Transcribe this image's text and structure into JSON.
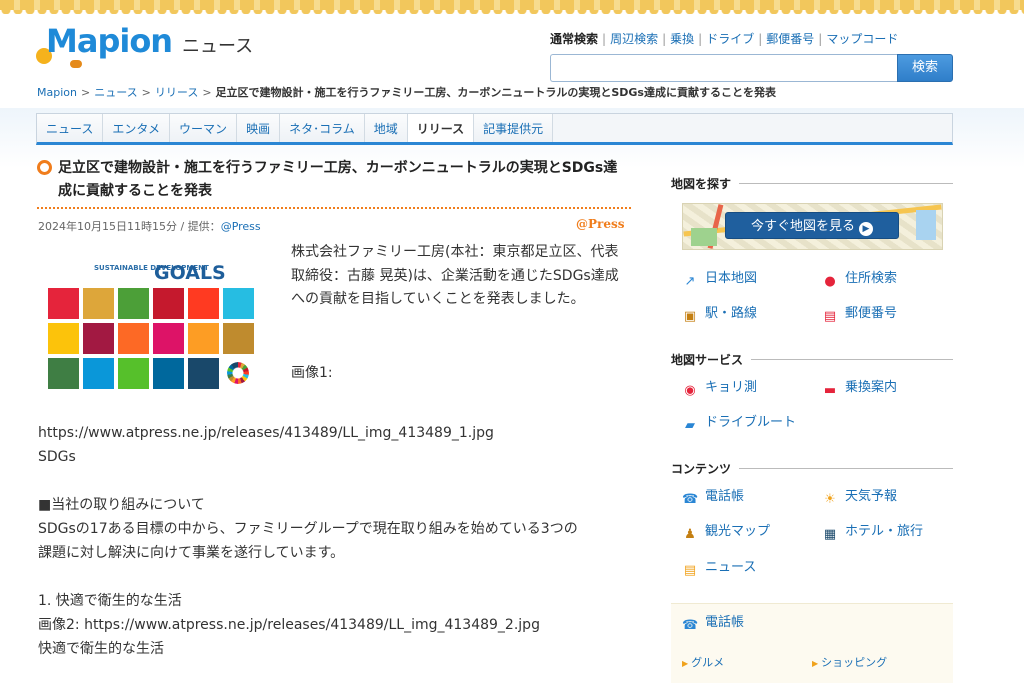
{
  "header": {
    "logo_text": "Mapion",
    "section": "ニュース",
    "search_links": [
      "通常検索",
      "周辺検索",
      "乗換",
      "ドライブ",
      "郵便番号",
      "マップコード"
    ],
    "search_current": "通常検索",
    "search_value": "",
    "search_button": "検索"
  },
  "breadcrumb": {
    "items": [
      "Mapion",
      "ニュース",
      "リリース"
    ],
    "current": "足立区で建物設計・施工を行うファミリー工房、カーボンニュートラルの実現とSDGs達成に貢献することを発表"
  },
  "nav": {
    "tabs": [
      "ニュース",
      "エンタメ",
      "ウーマン",
      "映画",
      "ネタ･コラム",
      "地域",
      "リリース",
      "記事提供元"
    ],
    "active": "リリース"
  },
  "article": {
    "title": "足立区で建物設計・施工を行うファミリー工房、カーボンニュートラルの実現とSDGs達成に貢献することを発表",
    "date": "2024年10月15日11時15分",
    "provider_prefix": "提供：",
    "provider": "@Press",
    "press_logo": "@Press",
    "sdgs_title": "SUSTAINABLE DEVELOPMENT",
    "sdgs_goals": "GOALS",
    "intro": "株式会社ファミリー工房(本社：東京都足立区、代表取締役：古藤 晃英)は、企業活動を通じたSDGs達成への貢献を目指していくことを発表しました。",
    "image1_label": "画像1:",
    "body_lines": [
      "https://www.atpress.ne.jp/releases/413489/LL_img_413489_1.jpg",
      "SDGs",
      "",
      "■当社の取り組みについて",
      "SDGsの17ある目標の中から、ファミリーグループで現在取り組みを始めている3つの",
      "課題に対し解決に向けて事業を遂行しています。",
      "",
      "1. 快適で衛生的な生活",
      "画像2: https://www.atpress.ne.jp/releases/413489/LL_img_413489_2.jpg",
      "快適で衛生的な生活"
    ]
  },
  "sidebar": {
    "find_map_heading": "地図を探す",
    "map_cta": "今すぐ地図を見る",
    "find_links": [
      "日本地図",
      "住所検索",
      "駅・路線",
      "郵便番号"
    ],
    "services_heading": "地図サービス",
    "service_links": [
      "キョリ測",
      "乗換案内",
      "ドライブルート"
    ],
    "contents_heading": "コンテンツ",
    "content_links": [
      "電話帳",
      "天気予報",
      "観光マップ",
      "ホテル・旅行",
      "ニュース"
    ],
    "phone_box_title": "電話帳",
    "phone_sub_links": [
      "グルメ",
      "ショッピング"
    ]
  },
  "sdg_colors": [
    "#e5243b",
    "#dda63a",
    "#4c9f38",
    "#c5192d",
    "#ff3a21",
    "#26bde2",
    "#fcc30b",
    "#a21942",
    "#fd6925",
    "#dd1367",
    "#fd9d24",
    "#bf8b2e",
    "#3f7e44",
    "#0a97d9",
    "#56c02b",
    "#00689d",
    "#19486a"
  ],
  "colors": {
    "link": "#1a6fb5",
    "accent_orange": "#f07d1c",
    "tab_border_blue": "#2a86d4"
  }
}
